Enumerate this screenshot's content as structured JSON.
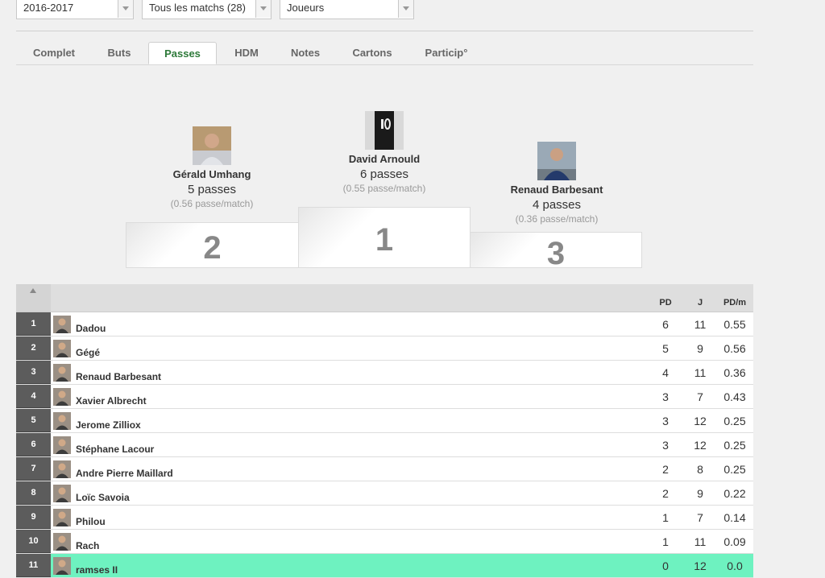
{
  "filters": {
    "season": "2016-2017",
    "matches": "Tous les matchs (28)",
    "scope": "Joueurs"
  },
  "tabs": [
    {
      "label": "Complet",
      "active": false
    },
    {
      "label": "Buts",
      "active": false
    },
    {
      "label": "Passes",
      "active": true
    },
    {
      "label": "HDM",
      "active": false
    },
    {
      "label": "Notes",
      "active": false
    },
    {
      "label": "Cartons",
      "active": false
    },
    {
      "label": "Particip°",
      "active": false
    }
  ],
  "podium": {
    "first": {
      "name": "David Arnould",
      "count": "6 passes",
      "avg": "(0.55 passe/match)",
      "rank": "1"
    },
    "second": {
      "name": "Gérald Umhang",
      "count": "5 passes",
      "avg": "(0.56 passe/match)",
      "rank": "2"
    },
    "third": {
      "name": "Renaud Barbesant",
      "count": "4 passes",
      "avg": "(0.36 passe/match)",
      "rank": "3"
    }
  },
  "table": {
    "headers": {
      "pd": "PD",
      "j": "J",
      "pdm": "PD/m"
    },
    "rows": [
      {
        "rank": "1",
        "name": "Dadou",
        "pd": "6",
        "j": "11",
        "pdm": "0.55"
      },
      {
        "rank": "2",
        "name": "Gégé",
        "pd": "5",
        "j": "9",
        "pdm": "0.56"
      },
      {
        "rank": "3",
        "name": "Renaud Barbesant",
        "pd": "4",
        "j": "11",
        "pdm": "0.36"
      },
      {
        "rank": "4",
        "name": "Xavier Albrecht",
        "pd": "3",
        "j": "7",
        "pdm": "0.43"
      },
      {
        "rank": "5",
        "name": "Jerome Zilliox",
        "pd": "3",
        "j": "12",
        "pdm": "0.25"
      },
      {
        "rank": "6",
        "name": "Stéphane Lacour",
        "pd": "3",
        "j": "12",
        "pdm": "0.25"
      },
      {
        "rank": "7",
        "name": "Andre Pierre Maillard",
        "pd": "2",
        "j": "8",
        "pdm": "0.25"
      },
      {
        "rank": "8",
        "name": "Loïc Savoia",
        "pd": "2",
        "j": "9",
        "pdm": "0.22"
      },
      {
        "rank": "9",
        "name": "Philou",
        "pd": "1",
        "j": "7",
        "pdm": "0.14"
      },
      {
        "rank": "10",
        "name": "Rach",
        "pd": "1",
        "j": "11",
        "pdm": "0.09"
      },
      {
        "rank": "11",
        "name": "ramses II",
        "pd": "0",
        "j": "12",
        "pdm": "0.0"
      }
    ]
  },
  "colors": {
    "active_tab_text": "#2e7a3a",
    "highlight_row": "#6ef2c0",
    "rank_cell": "#5c5c5c"
  }
}
